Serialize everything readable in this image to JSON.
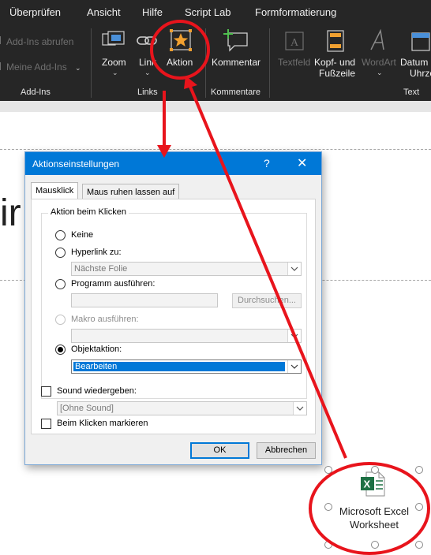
{
  "ribbon": {
    "tabs": [
      "Überprüfen",
      "Ansicht",
      "Hilfe",
      "Script Lab",
      "Formformatierung"
    ],
    "addins": {
      "get_label": "Add-Ins abrufen",
      "my_label": "Meine Add-Ins",
      "group_label": "Add-Ins"
    },
    "links": {
      "zoom_label": "Zoom",
      "link_label": "Link",
      "action_label": "Aktion",
      "group_label": "Links"
    },
    "comments": {
      "comment_label": "Kommentar",
      "group_label": "Kommentare"
    },
    "text": {
      "textbox_label": "Textfeld",
      "header_label_1": "Kopf- und",
      "header_label_2": "Fußzeile",
      "wordart_label": "WordArt",
      "date_label_1": "Datum u",
      "date_label_2": "Uhrze",
      "group_label": "Text"
    }
  },
  "slide": {
    "partial_text": "ir"
  },
  "dialog": {
    "title": "Aktionseinstellungen",
    "help": "?",
    "close": "✕",
    "tabs": [
      "Mausklick",
      "Maus ruhen lassen auf"
    ],
    "group_label": "Aktion beim Klicken",
    "options": {
      "none": "Keine",
      "hyperlink": "Hyperlink zu:",
      "hyperlink_value": "Nächste Folie",
      "program": "Programm ausführen:",
      "browse": "Durchsuchen...",
      "macro": "Makro ausführen:",
      "object_action": "Objektaktion:",
      "object_action_value": "Bearbeiten"
    },
    "selected_option": "object_action",
    "sound_label": "Sound wiedergeben:",
    "sound_value": "[Ohne Sound]",
    "highlight_label": "Beim Klicken markieren",
    "ok": "OK",
    "cancel": "Abbrechen"
  },
  "object": {
    "line1": "Microsoft Excel",
    "line2": "Worksheet",
    "icon_name": "excel-file-icon"
  },
  "colors": {
    "annotation": "#e8141c",
    "dialog_title": "#0078d7",
    "ribbon": "#262626",
    "excel": "#1d7044"
  }
}
